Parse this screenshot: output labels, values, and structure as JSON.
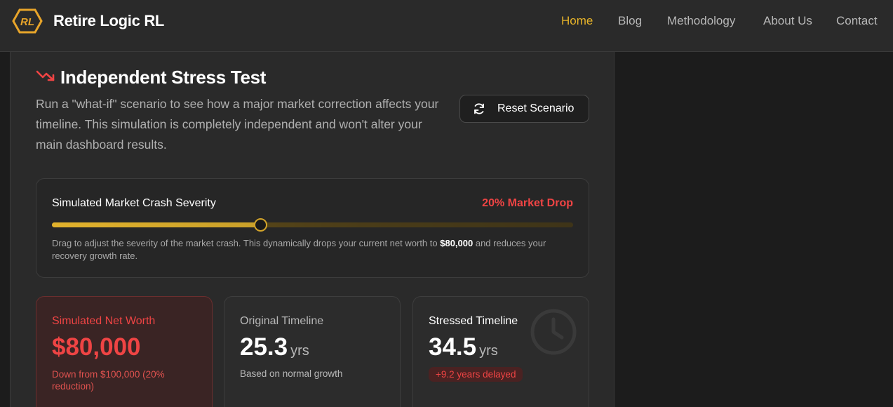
{
  "header": {
    "brand": "Retire Logic RL",
    "logo_text": "RL",
    "nav": [
      {
        "label": "Home",
        "active": true
      },
      {
        "label": "Blog",
        "active": false
      },
      {
        "label": "Methodology",
        "active": false
      },
      {
        "label": "About Us",
        "active": false
      },
      {
        "label": "Contact",
        "active": false
      }
    ]
  },
  "stress_test": {
    "title": "Independent Stress Test",
    "title_icon": "trending-down-icon",
    "description": "Run a \"what-if\" scenario to see how a major market correction affects your timeline. This simulation is completely independent and won't alter your main dashboard results.",
    "reset_label": "Reset Scenario",
    "reset_icon": "refresh-icon"
  },
  "slider": {
    "label": "Simulated Market Crash Severity",
    "value_label": "20% Market Drop",
    "fraction": 0.4,
    "help_before": "Drag to adjust the severity of the market crash. This dynamically drops your current net worth to ",
    "help_bold": "$80,000",
    "help_after": " and reduces your recovery growth rate."
  },
  "cards": {
    "simulated": {
      "label": "Simulated Net Worth",
      "value": "$80,000",
      "sub": "Down from $100,000 (20% reduction)"
    },
    "original": {
      "label": "Original Timeline",
      "value": "25.3",
      "unit": "yrs",
      "sub": "Based on normal growth"
    },
    "stressed": {
      "label": "Stressed Timeline",
      "value": "34.5",
      "unit": "yrs",
      "badge": "+9.2 years delayed",
      "icon": "clock-icon"
    }
  },
  "colors": {
    "accent": "#e8b429",
    "danger": "#ef4444",
    "background": "#1c1c1c",
    "panel": "#2a2a2a"
  }
}
